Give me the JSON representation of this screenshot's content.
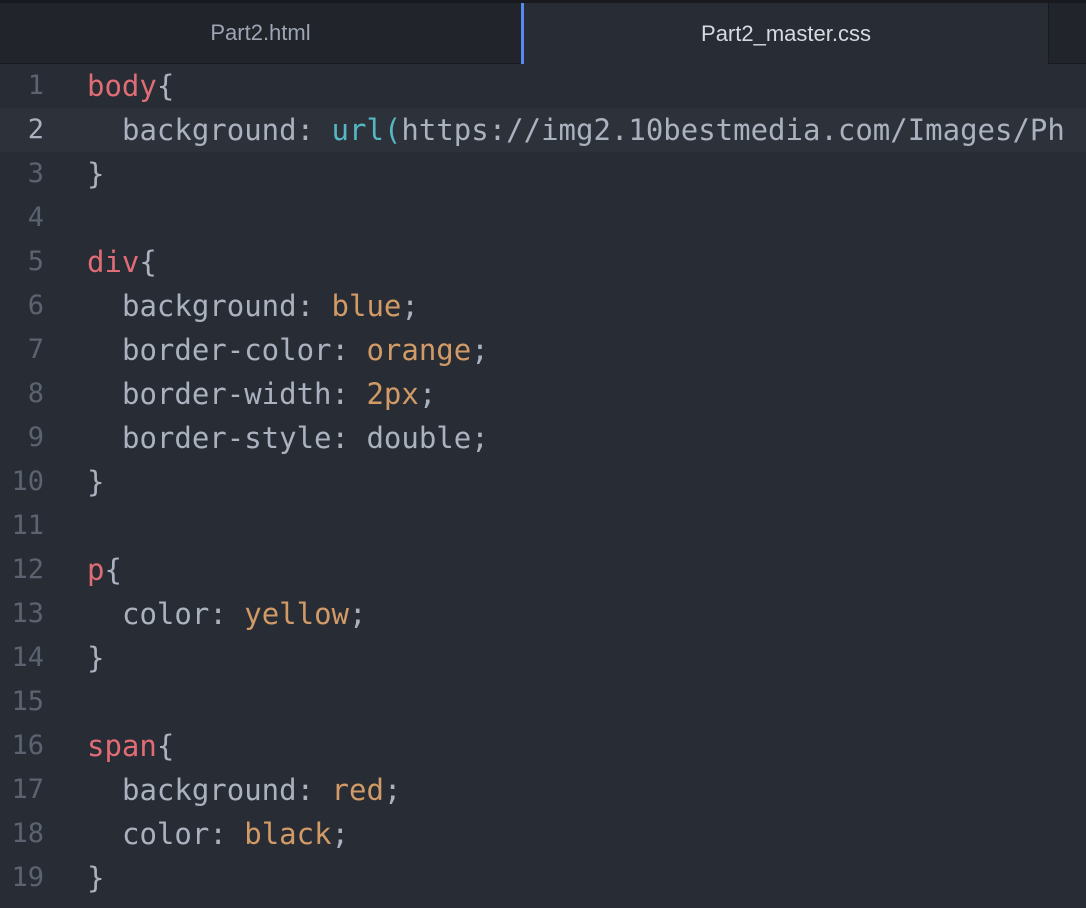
{
  "tabs": [
    {
      "label": "Part2.html",
      "active": false
    },
    {
      "label": "Part2_master.css",
      "active": true
    }
  ],
  "editor": {
    "current_line": 2,
    "lines": [
      {
        "num": "1",
        "selector": "body",
        "brace": "{"
      },
      {
        "num": "2",
        "prop": "background",
        "colon": ": ",
        "fn": "url",
        "paren": "(",
        "arg": "https://img2.10bestmedia.com/Images/Ph"
      },
      {
        "num": "3",
        "brace": "}"
      },
      {
        "num": "4"
      },
      {
        "num": "5",
        "selector": "div",
        "brace": "{"
      },
      {
        "num": "6",
        "prop": "background",
        "colon": ": ",
        "value": "blue",
        "semi": ";"
      },
      {
        "num": "7",
        "prop": "border-color",
        "colon": ": ",
        "value": "orange",
        "semi": ";"
      },
      {
        "num": "8",
        "prop": "border-width",
        "colon": ": ",
        "value": "2px",
        "semi": ";"
      },
      {
        "num": "9",
        "prop": "border-style",
        "colon": ": ",
        "plain": "double",
        "semi": ";"
      },
      {
        "num": "10",
        "brace": "}"
      },
      {
        "num": "11"
      },
      {
        "num": "12",
        "selector": "p",
        "brace": "{"
      },
      {
        "num": "13",
        "prop": "color",
        "colon": ": ",
        "value": "yellow",
        "semi": ";"
      },
      {
        "num": "14",
        "brace": "}"
      },
      {
        "num": "15"
      },
      {
        "num": "16",
        "selector": "span",
        "brace": "{"
      },
      {
        "num": "17",
        "prop": "background",
        "colon": ": ",
        "value": "red",
        "semi": ";"
      },
      {
        "num": "18",
        "prop": "color",
        "colon": ": ",
        "value": "black",
        "semi": ";"
      },
      {
        "num": "19",
        "brace": "}"
      }
    ]
  },
  "colors": {
    "background": "#282c34",
    "tab_bar": "#21252b",
    "active_tab_accent": "#568af2",
    "selector": "#e06c75",
    "value": "#d19a66",
    "function": "#56b6c2",
    "text": "#abb2bf",
    "gutter": "#5c6370"
  }
}
